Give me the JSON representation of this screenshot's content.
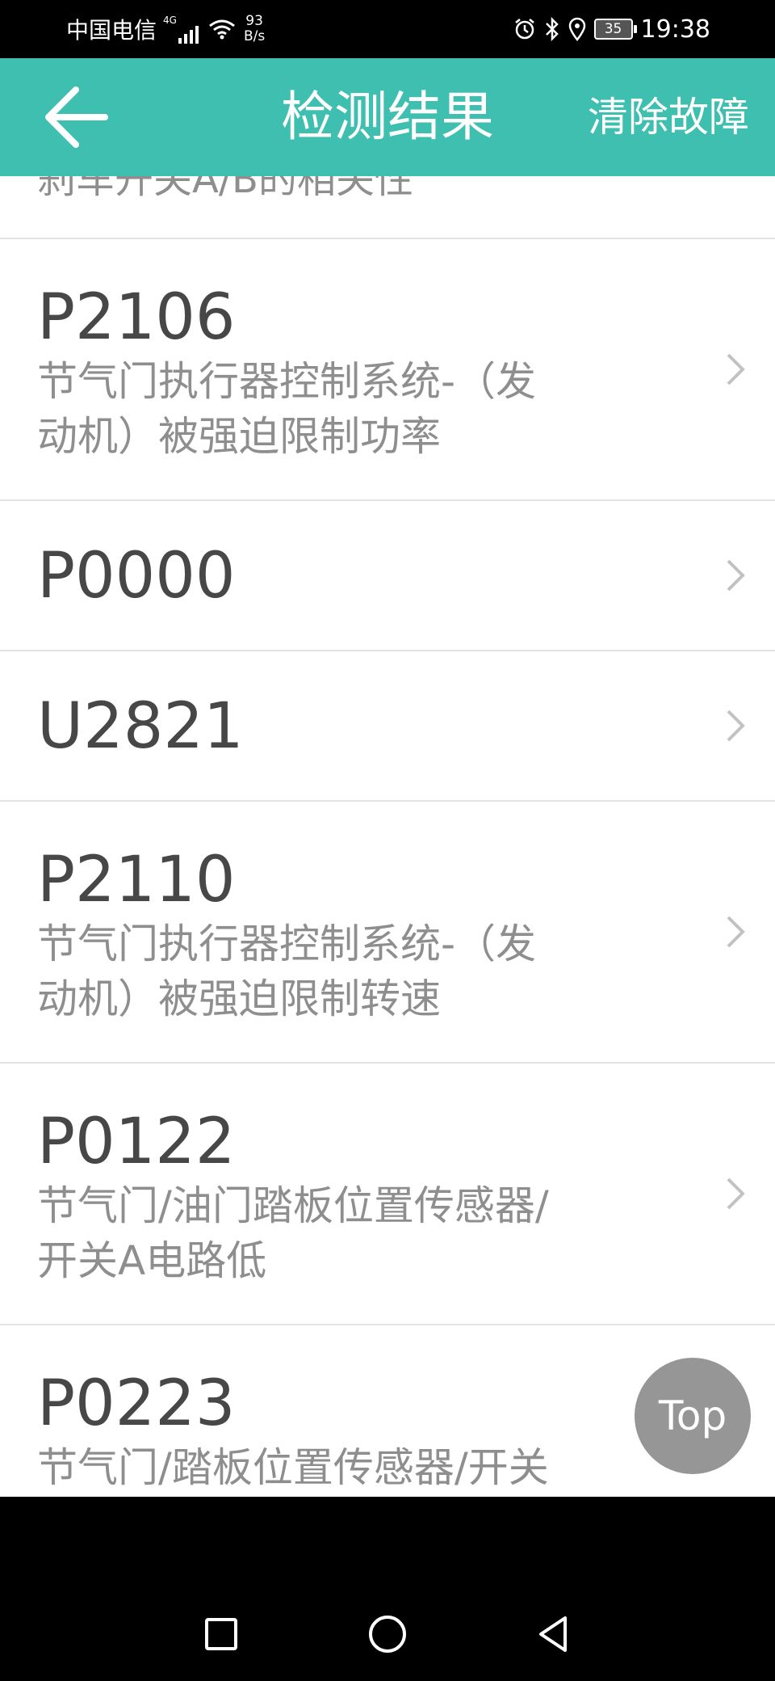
{
  "status_bar": {
    "carrier": "中国电信",
    "network_type": "4G",
    "speed_value": "93",
    "speed_unit": "B/s",
    "battery": "35",
    "time": "19:38"
  },
  "app_bar": {
    "back_icon": "arrow-left-icon",
    "title": "检测结果",
    "action_label": "清除故障"
  },
  "list": {
    "partial_item_text": "刹车开关A/B的相关性",
    "items": [
      {
        "code": "P2106",
        "desc_line1": "节气门执行器控制系统-（发",
        "desc_line2": "动机）被强迫限制功率"
      },
      {
        "code": "P0000"
      },
      {
        "code": "U2821"
      },
      {
        "code": "P2110",
        "desc_line1": "节气门执行器控制系统-（发",
        "desc_line2": "动机）被强迫限制转速"
      },
      {
        "code": "P0122",
        "desc_line1": "节气门/油门踏板位置传感器/",
        "desc_line2": "开关A电路低"
      },
      {
        "code": "P0223",
        "desc_line1": "节气门/踏板位置传感器/开关"
      }
    ]
  },
  "fab": {
    "label": "Top"
  },
  "nav_bar": {
    "recent_icon": "square-icon",
    "home_icon": "circle-icon",
    "back_icon": "triangle-back-icon"
  },
  "colors": {
    "accent": "#3ebfaf",
    "code_text": "#474747",
    "desc_text": "#8e8e8e"
  }
}
